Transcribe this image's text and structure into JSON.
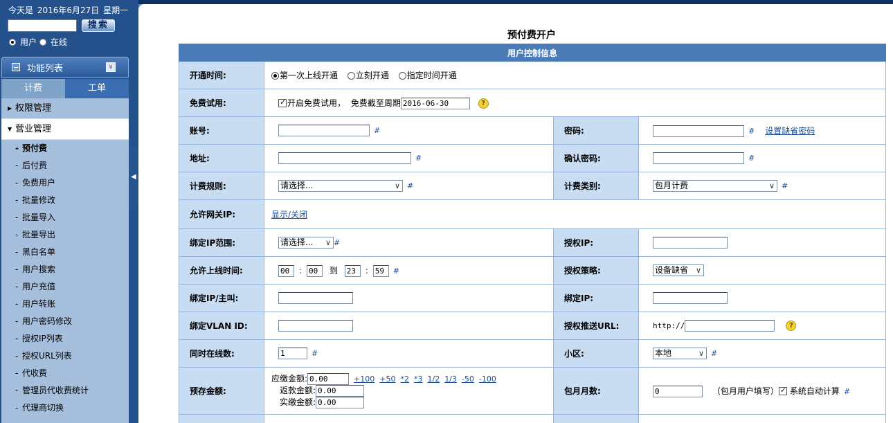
{
  "header": {
    "today_prefix": "今天是",
    "date": "2016年6月27日",
    "weekday": "星期一"
  },
  "search": {
    "button": "搜索",
    "options": [
      "用户",
      "在线"
    ],
    "selected": "用户"
  },
  "sidebar": {
    "title": "功能列表",
    "tabs": [
      "计费",
      "工单"
    ],
    "groups": [
      {
        "label": "权限管理",
        "open": false
      },
      {
        "label": "营业管理",
        "open": true
      }
    ],
    "items": [
      "预付费",
      "后付费",
      "免费用户",
      "批量修改",
      "批量导入",
      "批量导出",
      "黑白名单",
      "用户搜索",
      "用户充值",
      "用户转账",
      "用户密码修改",
      "授权IP列表",
      "授权URL列表",
      "代收费",
      "管理员代收费统计",
      "代理商切换"
    ],
    "active_item": "预付费"
  },
  "page": {
    "title": "预付费开户",
    "section": "用户控制信息"
  },
  "form": {
    "open_time": {
      "label": "开通时间:",
      "options": [
        "第一次上线开通",
        "立刻开通",
        "指定时间开通"
      ],
      "selected": "第一次上线开通"
    },
    "free_trial": {
      "label": "免费试用:",
      "checkbox_text": "开启免费试用，",
      "until_text": "免费截至周期",
      "date": "2016-06-30"
    },
    "account": {
      "label": "账号:",
      "hash": "#"
    },
    "password": {
      "label": "密码:",
      "hash": "#",
      "link": "设置缺省密码"
    },
    "address": {
      "label": "地址:",
      "hash": "#"
    },
    "confirm_password": {
      "label": "确认密码:",
      "hash": "#"
    },
    "billing_rule": {
      "label": "计费规则:",
      "value": "请选择...",
      "hash": "#"
    },
    "billing_type": {
      "label": "计费类别:",
      "value": "包月计费",
      "hash": "#"
    },
    "gateway_ip": {
      "label": "允许网关IP:",
      "link": "显示/关闭"
    },
    "bind_ip_range": {
      "label": "绑定IP范围:",
      "value": "请选择...",
      "hash": "#"
    },
    "auth_ip": {
      "label": "授权IP:"
    },
    "online_time": {
      "label": "允许上线时间:",
      "from_h": "00",
      "from_m": "00",
      "to_word": "到",
      "to_h": "23",
      "to_m": "59",
      "colon": ":",
      "hash": "#"
    },
    "auth_policy": {
      "label": "授权策略:",
      "value": "设备缺省"
    },
    "bind_ip_host": {
      "label": "绑定IP/主叫:"
    },
    "bind_ip": {
      "label": "绑定IP:"
    },
    "bind_vlan": {
      "label": "绑定VLAN ID:"
    },
    "auth_push_url": {
      "label": "授权推送URL:",
      "prefix": "http://"
    },
    "concurrent": {
      "label": "同时在线数:",
      "value": "1",
      "hash": "#"
    },
    "district": {
      "label": "小区:",
      "value": "本地",
      "hash": "#"
    },
    "prepaid": {
      "label": "预存金额:",
      "due_label": "应缴金额:",
      "due": "0.00",
      "quick": [
        "+100",
        "+50",
        "*2",
        "*3",
        "1/2",
        "1/3",
        "-50",
        "-100"
      ],
      "refund_label": "返款金额:",
      "refund": "0.00",
      "paid_label": "实缴金额:",
      "paid": "0.00"
    },
    "months": {
      "label": "包月月数:",
      "value": "0",
      "note": "（包月用户填写）",
      "auto_text": "系统自动计算",
      "hash": "#"
    }
  }
}
